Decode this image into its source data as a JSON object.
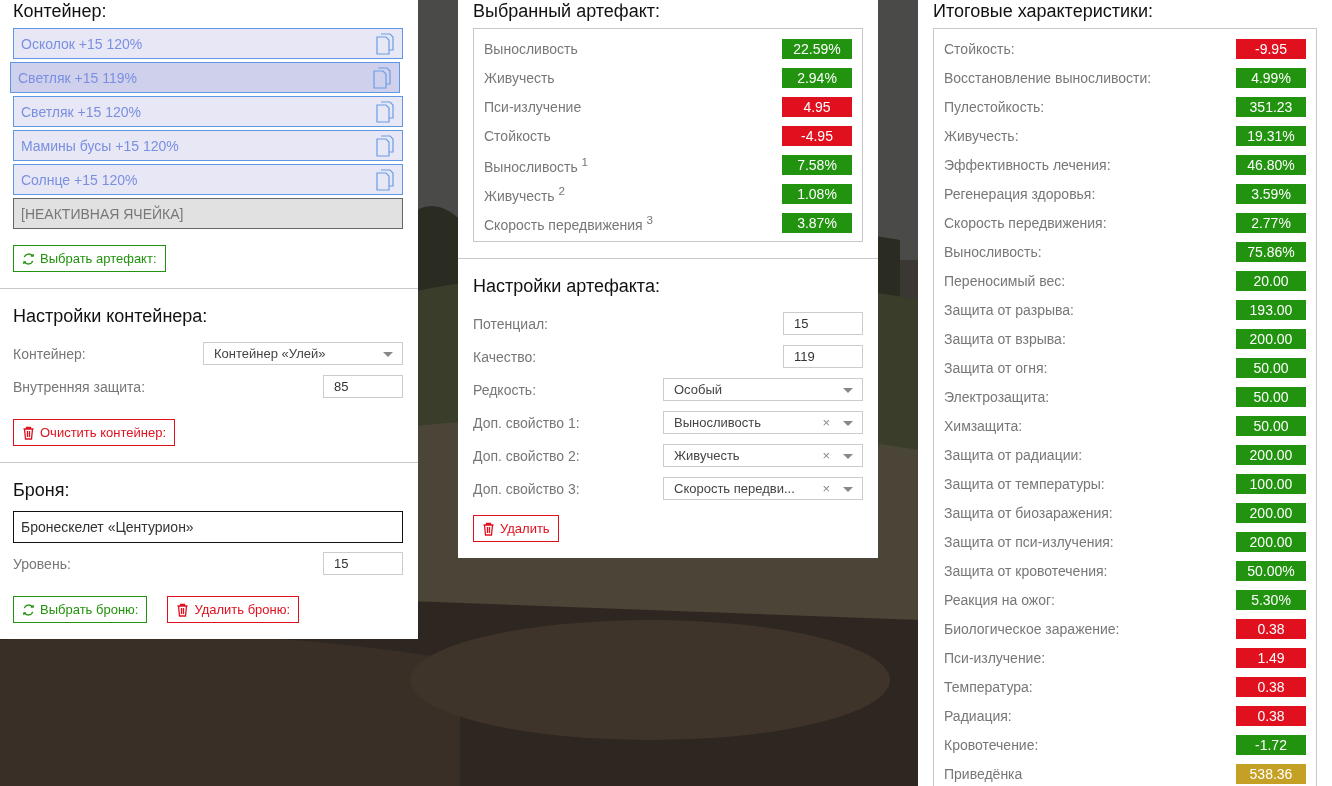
{
  "container": {
    "title": "Контейнер:",
    "slots": [
      {
        "kind": "artifact",
        "label": "Осколок +15 120%",
        "selected": false
      },
      {
        "kind": "artifact",
        "label": "Светляк +15 119%",
        "selected": true
      },
      {
        "kind": "artifact",
        "label": "Светляк +15 120%",
        "selected": false
      },
      {
        "kind": "artifact",
        "label": "Мамины бусы +15 120%",
        "selected": false
      },
      {
        "kind": "artifact",
        "label": "Солнце +15 120%",
        "selected": false
      },
      {
        "kind": "inactive",
        "label": "[НЕАКТИВНАЯ ЯЧЕЙКА]"
      }
    ],
    "choose_button": "Выбрать артефакт:"
  },
  "container_settings": {
    "title": "Настройки контейнера:",
    "fields": [
      {
        "kind": "select",
        "label": "Контейнер:",
        "value": "Контейнер «Улей»"
      },
      {
        "kind": "number",
        "label": "Внутренняя защита:",
        "value": "85"
      }
    ],
    "clear_button": "Очистить контейнер:"
  },
  "armor": {
    "title": "Броня:",
    "name": "Бронескелет «Центурион»",
    "level_label": "Уровень:",
    "level_value": "15",
    "choose_button": "Выбрать броню:",
    "delete_button": "Удалить броню:"
  },
  "selected_artifact": {
    "title": "Выбранный артефакт:",
    "stats": [
      {
        "label": "Выносливость",
        "value": "22.59%",
        "color": "#22930f"
      },
      {
        "label": "Живучесть",
        "value": "2.94%",
        "color": "#22930f"
      },
      {
        "label": "Пси-излучение",
        "value": "4.95",
        "color": "#e0101f"
      },
      {
        "label": "Стойкость",
        "value": "-4.95",
        "color": "#e0101f"
      },
      {
        "label": "Выносливость $^{1}$",
        "value": "7.58%",
        "color": "#22930f"
      },
      {
        "label": "Живучесть $^{2}$",
        "value": "1.08%",
        "color": "#22930f"
      },
      {
        "label": "Скорость передвижения $^{3}$",
        "value": "3.87%",
        "color": "#22930f"
      }
    ]
  },
  "artifact_settings": {
    "title": "Настройки артефакта:",
    "fields": [
      {
        "kind": "number",
        "label": "Потенциал:",
        "value": "15"
      },
      {
        "kind": "number",
        "label": "Качество:",
        "value": "119"
      },
      {
        "kind": "select",
        "label": "Редкость:",
        "value": "Особый"
      },
      {
        "kind": "clearable",
        "label": "Доп. свойство 1:",
        "value": "Выносливость",
        "clear": "×"
      },
      {
        "kind": "clearable",
        "label": "Доп. свойство 2:",
        "value": "Живучесть",
        "clear": "×"
      },
      {
        "kind": "clearable",
        "label": "Доп. свойство 3:",
        "value": "Скорость передви...",
        "clear": "×"
      }
    ],
    "delete_button": "Удалить"
  },
  "totals": {
    "title": "Итоговые характеристики:",
    "stats": [
      {
        "label": "Стойкость:",
        "value": "-9.95",
        "color": "#e0101f"
      },
      {
        "label": "Восстановление выносливости:",
        "value": "4.99%",
        "color": "#22930f"
      },
      {
        "label": "Пулестойкость:",
        "value": "351.23",
        "color": "#22930f"
      },
      {
        "label": "Живучесть:",
        "value": "19.31%",
        "color": "#22930f"
      },
      {
        "label": "Эффективность лечения:",
        "value": "46.80%",
        "color": "#22930f"
      },
      {
        "label": "Регенерация здоровья:",
        "value": "3.59%",
        "color": "#22930f"
      },
      {
        "label": "Скорость передвижения:",
        "value": "2.77%",
        "color": "#22930f"
      },
      {
        "label": "Выносливость:",
        "value": "75.86%",
        "color": "#22930f"
      },
      {
        "label": "Переносимый вес:",
        "value": "20.00",
        "color": "#22930f"
      },
      {
        "label": "Защита от разрыва:",
        "value": "193.00",
        "color": "#22930f"
      },
      {
        "label": "Защита от взрыва:",
        "value": "200.00",
        "color": "#22930f"
      },
      {
        "label": "Защита от огня:",
        "value": "50.00",
        "color": "#22930f"
      },
      {
        "label": "Электрозащита:",
        "value": "50.00",
        "color": "#22930f"
      },
      {
        "label": "Химзащита:",
        "value": "50.00",
        "color": "#22930f"
      },
      {
        "label": "Защита от радиации:",
        "value": "200.00",
        "color": "#22930f"
      },
      {
        "label": "Защита от температуры:",
        "value": "100.00",
        "color": "#22930f"
      },
      {
        "label": "Защита от биозаражения:",
        "value": "200.00",
        "color": "#22930f"
      },
      {
        "label": "Защита от пси-излучения:",
        "value": "200.00",
        "color": "#22930f"
      },
      {
        "label": "Защита от кровотечения:",
        "value": "50.00%",
        "color": "#22930f"
      },
      {
        "label": "Реакция на ожог:",
        "value": "5.30%",
        "color": "#22930f"
      },
      {
        "label": "Биологическое заражение:",
        "value": "0.38",
        "color": "#e0101f"
      },
      {
        "label": "Пси-излучение:",
        "value": "1.49",
        "color": "#e0101f"
      },
      {
        "label": "Температура:",
        "value": "0.38",
        "color": "#e0101f"
      },
      {
        "label": "Радиация:",
        "value": "0.38",
        "color": "#e0101f"
      },
      {
        "label": "Кровотечение:",
        "value": "-1.72",
        "color": "#22930f"
      },
      {
        "label": "Приведёнка",
        "value": "538.36",
        "color": "#c4a025"
      }
    ]
  }
}
